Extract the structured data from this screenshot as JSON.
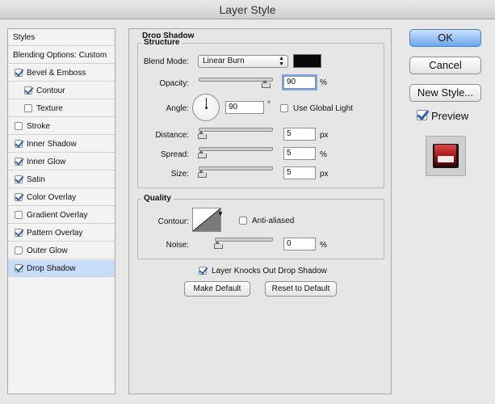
{
  "window": {
    "title": "Layer Style"
  },
  "sidebar": {
    "header": "Styles",
    "blending": "Blending Options: Custom",
    "items": [
      {
        "label": "Bevel & Emboss",
        "checked": true,
        "indent": false
      },
      {
        "label": "Contour",
        "checked": true,
        "indent": true
      },
      {
        "label": "Texture",
        "checked": false,
        "indent": true
      },
      {
        "label": "Stroke",
        "checked": false,
        "indent": false
      },
      {
        "label": "Inner Shadow",
        "checked": true,
        "indent": false
      },
      {
        "label": "Inner Glow",
        "checked": true,
        "indent": false
      },
      {
        "label": "Satin",
        "checked": true,
        "indent": false
      },
      {
        "label": "Color Overlay",
        "checked": true,
        "indent": false
      },
      {
        "label": "Gradient Overlay",
        "checked": false,
        "indent": false
      },
      {
        "label": "Pattern Overlay",
        "checked": true,
        "indent": false
      },
      {
        "label": "Outer Glow",
        "checked": false,
        "indent": false
      },
      {
        "label": "Drop Shadow",
        "checked": true,
        "indent": false,
        "selected": true
      }
    ]
  },
  "panel": {
    "title": "Drop Shadow",
    "structure": {
      "title": "Structure",
      "blend_mode_label": "Blend Mode:",
      "blend_mode_value": "Linear Burn",
      "blend_color": "#080808",
      "opacity_label": "Opacity:",
      "opacity_value": "90",
      "opacity_percent": 90,
      "percent": "%",
      "angle_label": "Angle:",
      "angle_value": "90",
      "degree": "°",
      "global_light_label": "Use Global Light",
      "global_light_checked": false,
      "distance_label": "Distance:",
      "distance_value": "5",
      "spread_label": "Spread:",
      "spread_value": "5",
      "size_label": "Size:",
      "size_value": "5",
      "px": "px"
    },
    "quality": {
      "title": "Quality",
      "contour_label": "Contour:",
      "anti_aliased_label": "Anti-aliased",
      "anti_aliased_checked": false,
      "noise_label": "Noise:",
      "noise_value": "0",
      "percent": "%"
    },
    "knockout_label": "Layer Knocks Out Drop Shadow",
    "knockout_checked": true,
    "make_default": "Make Default",
    "reset_default": "Reset to Default"
  },
  "actions": {
    "ok": "OK",
    "cancel": "Cancel",
    "new_style": "New Style...",
    "preview": "Preview",
    "preview_checked": true
  },
  "colors": {
    "accent": "#6aa6ec",
    "selected_row": "#c7dcf8"
  }
}
